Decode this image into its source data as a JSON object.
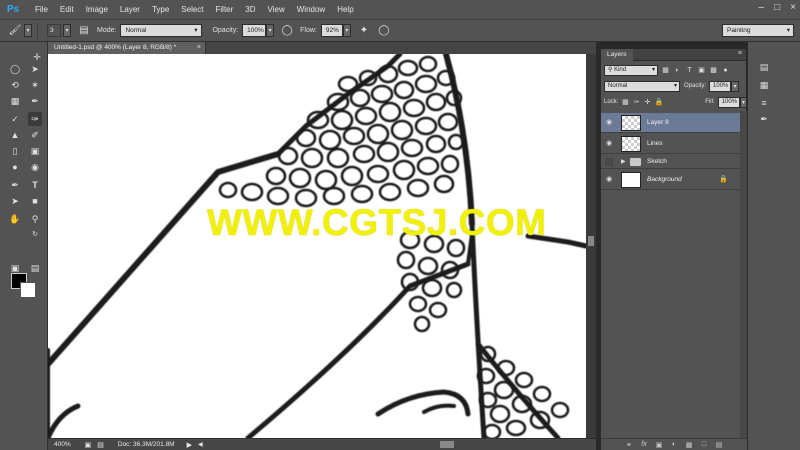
{
  "menubar": {
    "logo": "Ps",
    "items": [
      "File",
      "Edit",
      "Image",
      "Layer",
      "Type",
      "Select",
      "Filter",
      "3D",
      "View",
      "Window",
      "Help"
    ]
  },
  "options": {
    "brush_size": "3",
    "mode_label": "Mode:",
    "mode_value": "Normal",
    "opacity_label": "Opacity:",
    "opacity_value": "100%",
    "flow_label": "Flow:",
    "flow_value": "92%",
    "workspace": "Painting"
  },
  "document": {
    "tab_title": "Untitled-1.psd @ 400% (Layer 8, RGB/8) *",
    "watermark": "WWW.CGTSJ.COM"
  },
  "status": {
    "zoom": "400%",
    "doc_info": "Doc: 36.3M/201.8M"
  },
  "layers_panel": {
    "tab": "Layers",
    "filter": "Kind",
    "blend_mode": "Normal",
    "opacity_label": "Opacity:",
    "opacity_value": "100%",
    "lock_label": "Lock:",
    "fill_label": "Fill:",
    "fill_value": "100%",
    "layers": [
      {
        "name": "Layer 8",
        "selected": true
      },
      {
        "name": "Lines",
        "selected": false
      },
      {
        "name": "Sketch",
        "type": "group"
      },
      {
        "name": "Background",
        "locked": true
      }
    ]
  },
  "colors": {
    "foreground": "#000000",
    "background": "#ffffff",
    "selection": "#6b7a97",
    "watermark": "#f2f200"
  }
}
